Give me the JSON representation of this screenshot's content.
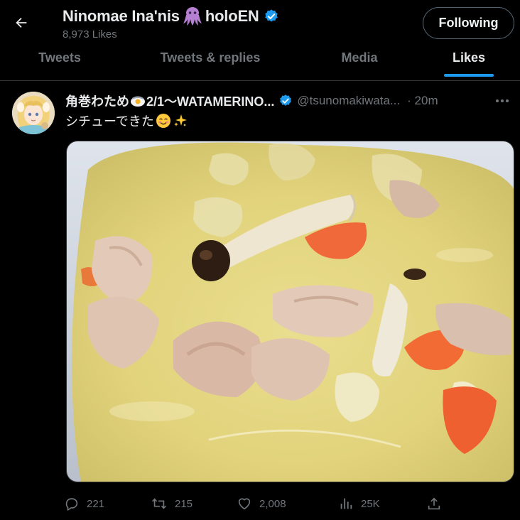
{
  "header": {
    "title_name": "Ninomae Ina'nis",
    "title_suffix": "holoEN",
    "subcount": "8,973 Likes",
    "follow_label": "Following",
    "icons": [
      "back-arrow-icon",
      "octopus-icon",
      "verified-badge-icon"
    ]
  },
  "tabs": [
    {
      "label": "Tweets",
      "active": false
    },
    {
      "label": "Tweets & replies",
      "active": false
    },
    {
      "label": "Media",
      "active": false
    },
    {
      "label": "Likes",
      "active": true
    }
  ],
  "tweet": {
    "author_part1": "角巻わため",
    "author_part2": "2/1〜WATAMERINO...",
    "handle": "@tsunomakiwata...",
    "time": "· 20m",
    "text": "シチューできた",
    "media_description": "",
    "actions": {
      "replies": "221",
      "retweets": "215",
      "likes": "2,008",
      "views": "25K"
    }
  },
  "colors": {
    "background": "#000000",
    "text_primary": "#e7e9ea",
    "text_secondary": "#71767b",
    "accent": "#1d9bf0",
    "border": "#2f3336"
  }
}
